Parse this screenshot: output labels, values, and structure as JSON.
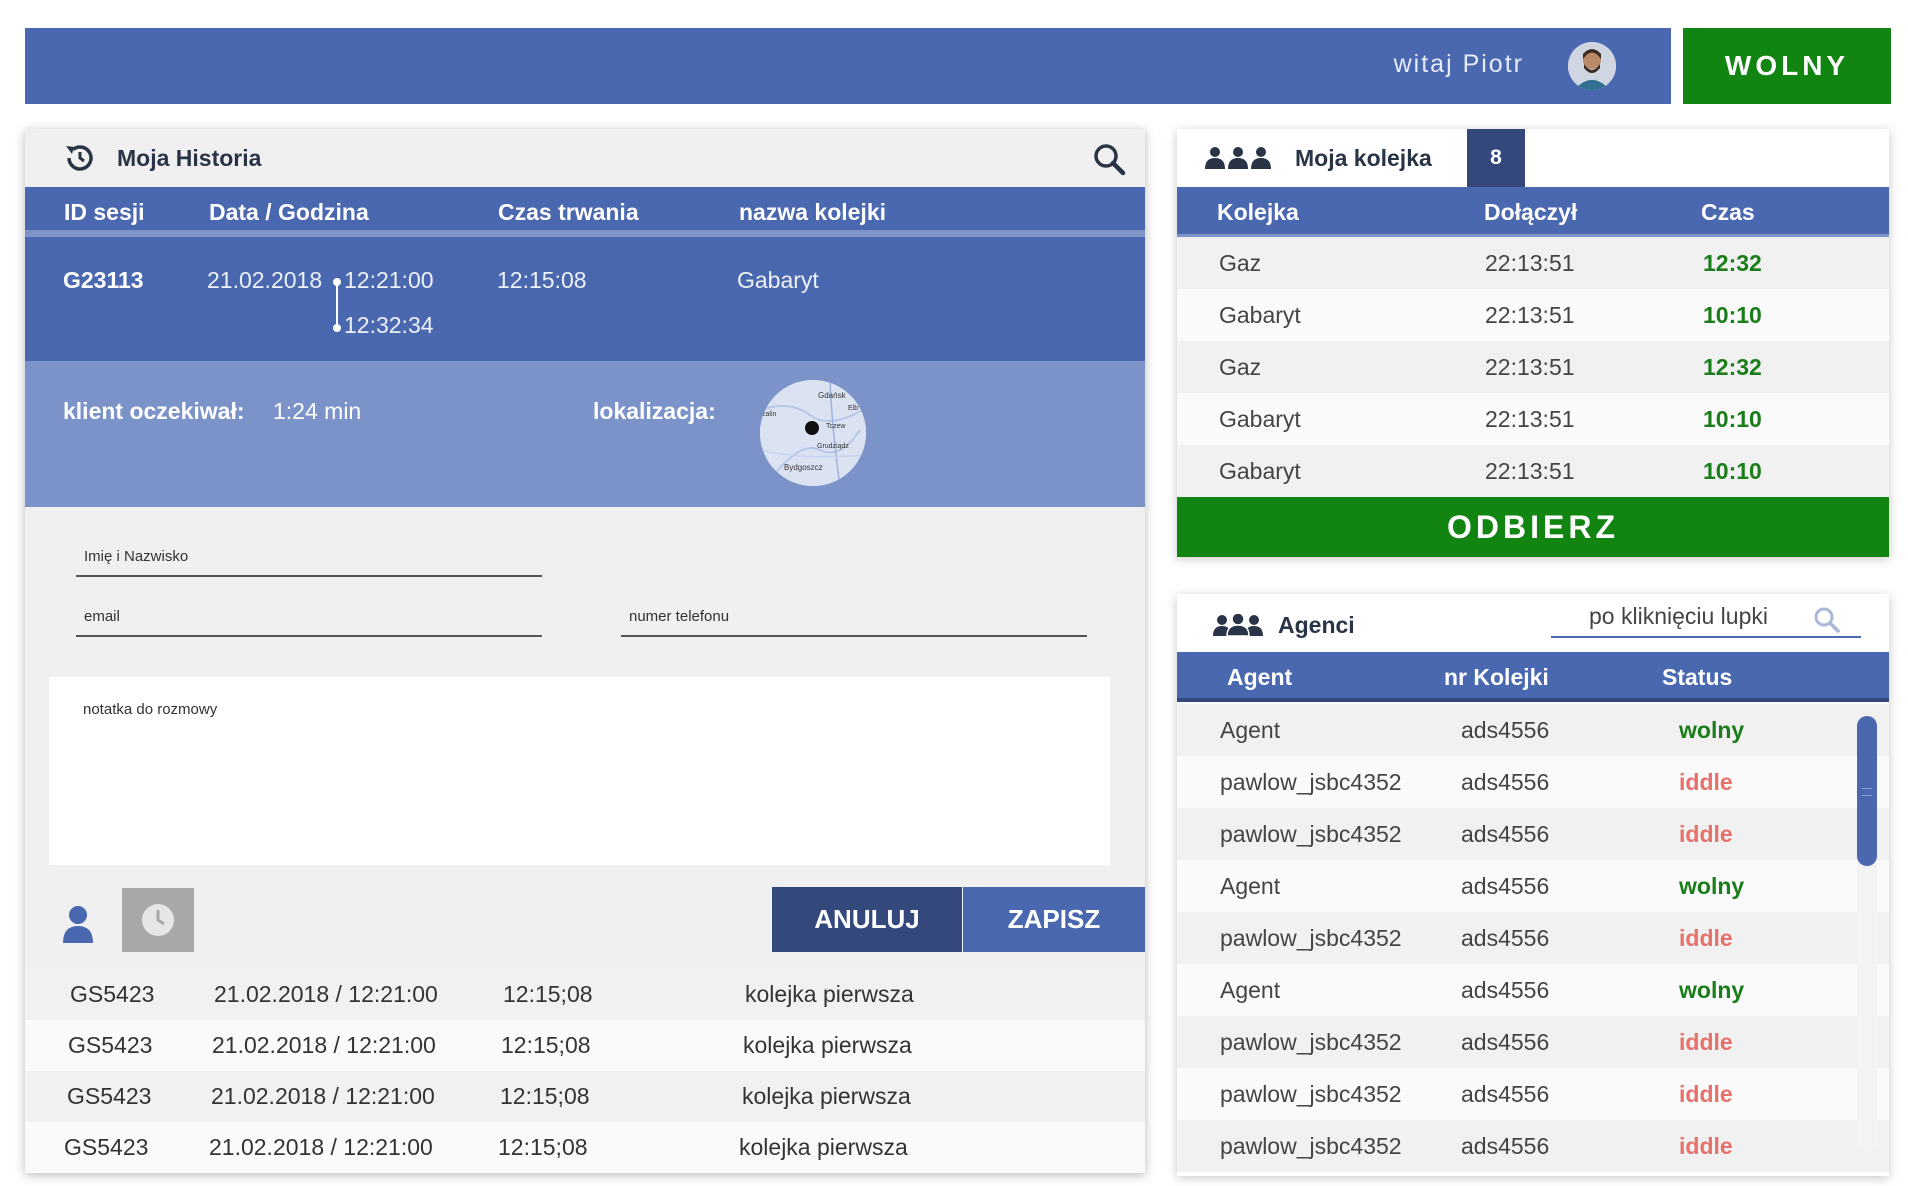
{
  "topbar": {
    "greeting": "witaj Piotr",
    "status_label": "WOLNY",
    "status_color": "#118411",
    "bar_color": "#4a68b0"
  },
  "history": {
    "title": "Moja Historia",
    "icon": "history-icon",
    "columns": [
      "ID sesji",
      "Data / Godzina",
      "Czas trwania",
      "nazwa kolejki"
    ],
    "active": {
      "id": "G23113",
      "date": "21.02.2018",
      "start": "12:21:00",
      "end": "12:32:34",
      "duration": "12:15:08",
      "queue": "Gabaryt",
      "wait_label": "klient oczekiwał:",
      "wait_value": "1:24 min",
      "location_label": "lokalizacja:",
      "map_labels": [
        "Gdańsk",
        "Elb",
        "zalin",
        "Tczew",
        "Grudziądz",
        "Bydgoszcz"
      ]
    },
    "form": {
      "name_placeholder": "Imię i Nazwisko",
      "email_placeholder": "email",
      "phone_placeholder": "numer telefonu",
      "note_placeholder": "notatka do rozmowy",
      "cancel_label": "ANULUJ",
      "save_label": "ZAPISZ"
    },
    "rows": [
      {
        "id": "GS5423",
        "datetime": "21.02.2018 / 12:21:00",
        "duration": "12:15;08",
        "queue": "kolejka pierwsza"
      },
      {
        "id": "GS5423",
        "datetime": "21.02.2018 / 12:21:00",
        "duration": "12:15;08",
        "queue": "kolejka pierwsza"
      },
      {
        "id": "GS5423",
        "datetime": "21.02.2018 / 12:21:00",
        "duration": "12:15;08",
        "queue": "kolejka pierwsza"
      },
      {
        "id": "GS5423",
        "datetime": "21.02.2018 / 12:21:00",
        "duration": "12:15;08",
        "queue": "kolejka pierwsza"
      }
    ]
  },
  "queue": {
    "title": "Moja kolejka",
    "count": "8",
    "columns": [
      "Kolejka",
      "Dołączył",
      "Czas"
    ],
    "rows": [
      {
        "queue": "Gaz",
        "joined": "22:13:51",
        "time": "12:32"
      },
      {
        "queue": "Gabaryt",
        "joined": "22:13:51",
        "time": "10:10"
      },
      {
        "queue": "Gaz",
        "joined": "22:13:51",
        "time": "12:32"
      },
      {
        "queue": "Gabaryt",
        "joined": "22:13:51",
        "time": "10:10"
      },
      {
        "queue": "Gabaryt",
        "joined": "22:13:51",
        "time": "10:10"
      }
    ],
    "answer_label": "ODBIERZ"
  },
  "agents": {
    "title": "Agenci",
    "search_placeholder": "po kliknięciu lupki",
    "columns": [
      "Agent",
      "nr Kolejki",
      "Status"
    ],
    "status_colors": {
      "wolny": "#1a7d1a",
      "iddle": "#e8706b"
    },
    "rows": [
      {
        "agent": "Agent",
        "queue_no": "ads4556",
        "status": "wolny"
      },
      {
        "agent": "pawlow_jsbc4352",
        "queue_no": "ads4556",
        "status": "iddle"
      },
      {
        "agent": "pawlow_jsbc4352",
        "queue_no": "ads4556",
        "status": "iddle"
      },
      {
        "agent": "Agent",
        "queue_no": "ads4556",
        "status": "wolny"
      },
      {
        "agent": "pawlow_jsbc4352",
        "queue_no": "ads4556",
        "status": "iddle"
      },
      {
        "agent": "Agent",
        "queue_no": "ads4556",
        "status": "wolny"
      },
      {
        "agent": "pawlow_jsbc4352",
        "queue_no": "ads4556",
        "status": "iddle"
      },
      {
        "agent": "pawlow_jsbc4352",
        "queue_no": "ads4556",
        "status": "iddle"
      },
      {
        "agent": "pawlow_jsbc4352",
        "queue_no": "ads4556",
        "status": "iddle"
      }
    ]
  }
}
